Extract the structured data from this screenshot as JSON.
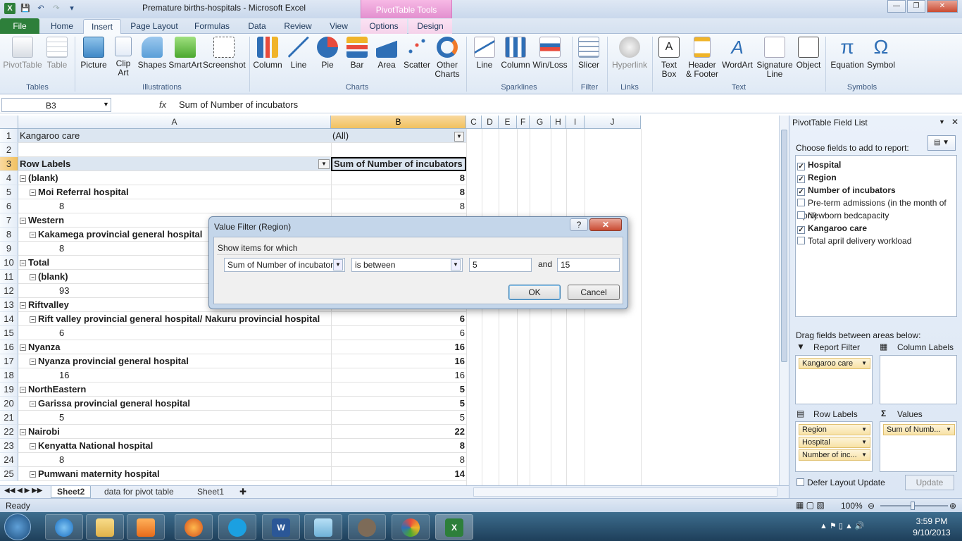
{
  "app": {
    "title": "Premature births-hospitals  -  Microsoft Excel",
    "context_title": "PivotTable Tools"
  },
  "tabs": [
    "File",
    "Home",
    "Insert",
    "Page Layout",
    "Formulas",
    "Data",
    "Review",
    "View",
    "Options",
    "Design"
  ],
  "ribbon": {
    "tables": {
      "pivot": "PivotTable",
      "table": "Table",
      "group": "Tables"
    },
    "illustrations": {
      "picture": "Picture",
      "clip1": "Clip",
      "clip2": "Art",
      "shapes": "Shapes",
      "smartart": "SmartArt",
      "screenshot": "Screenshot",
      "group": "Illustrations"
    },
    "charts": {
      "column": "Column",
      "line": "Line",
      "pie": "Pie",
      "bar": "Bar",
      "area": "Area",
      "scatter": "Scatter",
      "other1": "Other",
      "other2": "Charts",
      "group": "Charts"
    },
    "sparklines": {
      "line": "Line",
      "column": "Column",
      "winloss": "Win/Loss",
      "group": "Sparklines"
    },
    "filter": {
      "slicer": "Slicer",
      "group": "Filter"
    },
    "links": {
      "hyperlink": "Hyperlink",
      "group": "Links"
    },
    "text": {
      "tb1": "Text",
      "tb2": "Box",
      "hf1": "Header",
      "hf2": "& Footer",
      "wordart": "WordArt",
      "sig1": "Signature",
      "sig2": "Line",
      "object": "Object",
      "group": "Text"
    },
    "symbols": {
      "equation": "Equation",
      "symbol": "Symbol",
      "group": "Symbols"
    }
  },
  "formula_bar": {
    "name_box": "B3",
    "fx": "fx",
    "content": "Sum of Number of incubators"
  },
  "columns": [
    "A",
    "B",
    "C",
    "D",
    "E",
    "F",
    "G",
    "H",
    "I",
    "J"
  ],
  "rows": [
    {
      "n": "1",
      "a": "Kangaroo care",
      "b": "(All)",
      "indent": 0,
      "bold": false
    },
    {
      "n": "2",
      "a": "",
      "b": "",
      "indent": 0,
      "bold": false
    },
    {
      "n": "3",
      "a": "Row Labels",
      "b": "Sum of Number of incubators",
      "indent": 0,
      "bold": true
    },
    {
      "n": "4",
      "a": "(blank)",
      "b": "8",
      "indent": 0,
      "bold": true,
      "exp": true
    },
    {
      "n": "5",
      "a": "Moi Referral hospital",
      "b": "8",
      "indent": 1,
      "bold": true,
      "exp": true
    },
    {
      "n": "6",
      "a": "8",
      "b": "8",
      "indent": 2,
      "bold": false
    },
    {
      "n": "7",
      "a": "Western",
      "b": "",
      "indent": 0,
      "bold": true,
      "exp": true
    },
    {
      "n": "8",
      "a": "Kakamega provincial general hospital",
      "b": "",
      "indent": 1,
      "bold": true,
      "exp": true
    },
    {
      "n": "9",
      "a": "8",
      "b": "",
      "indent": 2,
      "bold": false
    },
    {
      "n": "10",
      "a": "Total",
      "b": "",
      "indent": 0,
      "bold": true,
      "exp": true
    },
    {
      "n": "11",
      "a": "(blank)",
      "b": "",
      "indent": 1,
      "bold": true,
      "exp": true
    },
    {
      "n": "12",
      "a": "93",
      "b": "",
      "indent": 2,
      "bold": false
    },
    {
      "n": "13",
      "a": "Riftvalley",
      "b": "",
      "indent": 0,
      "bold": true,
      "exp": true
    },
    {
      "n": "14",
      "a": "Rift valley provincial general hospital/ Nakuru provincial hospital",
      "b": "6",
      "indent": 1,
      "bold": true,
      "exp": true
    },
    {
      "n": "15",
      "a": "6",
      "b": "6",
      "indent": 2,
      "bold": false
    },
    {
      "n": "16",
      "a": "Nyanza",
      "b": "16",
      "indent": 0,
      "bold": true,
      "exp": true
    },
    {
      "n": "17",
      "a": "Nyanza provincial general hospital",
      "b": "16",
      "indent": 1,
      "bold": true,
      "exp": true
    },
    {
      "n": "18",
      "a": "16",
      "b": "16",
      "indent": 2,
      "bold": false
    },
    {
      "n": "19",
      "a": "NorthEastern",
      "b": "5",
      "indent": 0,
      "bold": true,
      "exp": true
    },
    {
      "n": "20",
      "a": "Garissa provincial general hospital",
      "b": "5",
      "indent": 1,
      "bold": true,
      "exp": true
    },
    {
      "n": "21",
      "a": "5",
      "b": "5",
      "indent": 2,
      "bold": false
    },
    {
      "n": "22",
      "a": "Nairobi",
      "b": "22",
      "indent": 0,
      "bold": true,
      "exp": true
    },
    {
      "n": "23",
      "a": "Kenyatta National hospital",
      "b": "8",
      "indent": 1,
      "bold": true,
      "exp": true
    },
    {
      "n": "24",
      "a": "8",
      "b": "8",
      "indent": 2,
      "bold": false
    },
    {
      "n": "25",
      "a": "Pumwani maternity hospital",
      "b": "14",
      "indent": 1,
      "bold": true,
      "exp": true
    }
  ],
  "sheets": [
    "Sheet2",
    "data for pivot table",
    "Sheet1"
  ],
  "status": {
    "ready": "Ready",
    "zoom": "100%"
  },
  "field_list": {
    "title": "PivotTable Field List",
    "choose": "Choose fields to add to report:",
    "fields": [
      {
        "name": "Hospital",
        "checked": true
      },
      {
        "name": "Region",
        "checked": true
      },
      {
        "name": "Number of incubators",
        "checked": true
      },
      {
        "name": "Pre-term admissions (in the month of April)",
        "checked": false
      },
      {
        "name": "Newborn bedcapacity",
        "checked": false
      },
      {
        "name": "Kangaroo care",
        "checked": true
      },
      {
        "name": "Total april delivery workload",
        "checked": false
      }
    ],
    "drag": "Drag fields between areas below:",
    "report_filter": "Report Filter",
    "column_labels": "Column Labels",
    "row_labels": "Row Labels",
    "values": "Values",
    "filter_items": [
      "Kangaroo care"
    ],
    "row_items": [
      "Region",
      "Hospital",
      "Number of inc..."
    ],
    "value_items": [
      "Sum of Numb..."
    ],
    "defer": "Defer Layout Update",
    "update": "Update"
  },
  "dialog": {
    "title": "Value Filter (Region)",
    "help": "?",
    "group_label": "Show items for which",
    "field": "Sum of Number of incubators",
    "operator": "is between",
    "value1": "5",
    "and": "and",
    "value2": "15",
    "ok": "OK",
    "cancel": "Cancel"
  },
  "clock": {
    "time": "3:59 PM",
    "date": "9/10/2013"
  },
  "colors": {
    "excel_green": "#2d7f3a",
    "ctx_pink": "#e28fcf",
    "selection": "#f1c15f"
  }
}
